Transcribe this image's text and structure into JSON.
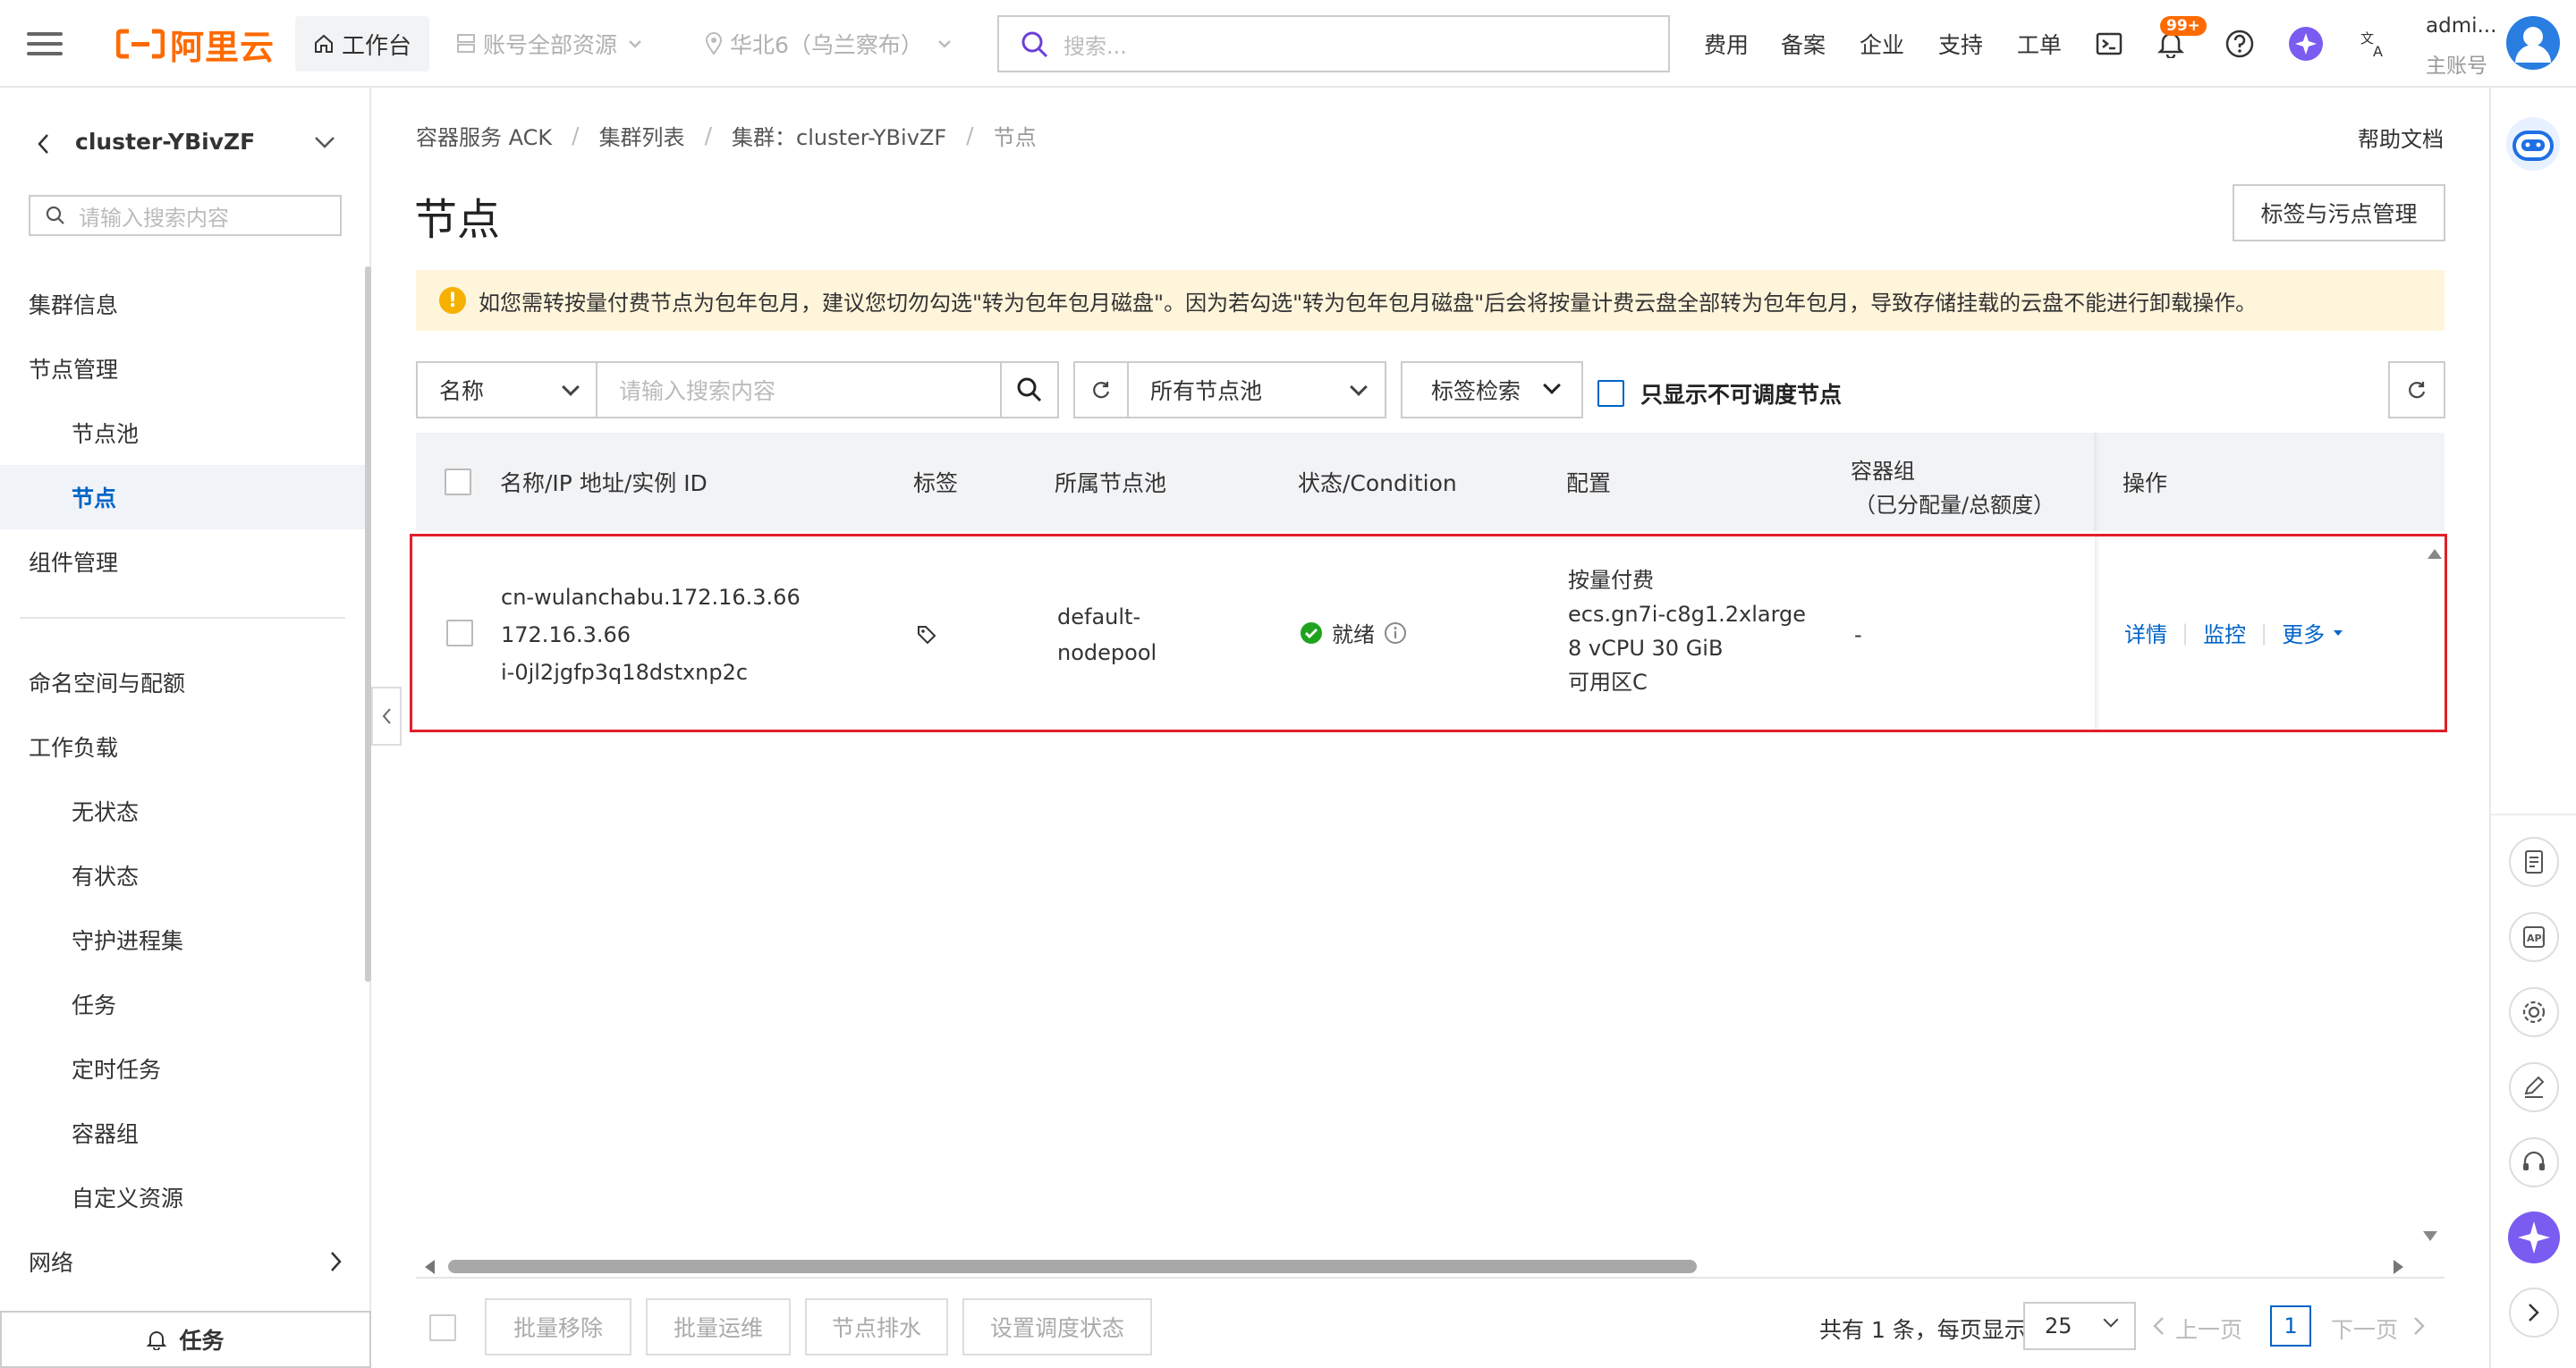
{
  "topbar": {
    "logo": "阿里云",
    "workbench": "工作台",
    "resource_group": "账号全部资源",
    "region": "华北6（乌兰察布）",
    "search_placeholder": "搜索...",
    "links": [
      "费用",
      "备案",
      "企业",
      "支持",
      "工单"
    ],
    "notification_count": "99+",
    "user_name": "admi...",
    "user_role": "主账号"
  },
  "sidebar": {
    "cluster_name": "cluster-YBivZF",
    "search_placeholder": "请输入搜索内容",
    "items": [
      {
        "label": "集群信息"
      },
      {
        "label": "节点管理"
      },
      {
        "label": "节点池"
      },
      {
        "label": "节点"
      },
      {
        "label": "组件管理"
      },
      {
        "label": "命名空间与配额"
      },
      {
        "label": "工作负载"
      },
      {
        "label": "无状态"
      },
      {
        "label": "有状态"
      },
      {
        "label": "守护进程集"
      },
      {
        "label": "任务"
      },
      {
        "label": "定时任务"
      },
      {
        "label": "容器组"
      },
      {
        "label": "自定义资源"
      },
      {
        "label": "网络"
      }
    ],
    "tasks_label": "任务"
  },
  "breadcrumb": [
    "容器服务 ACK",
    "集群列表",
    "集群：cluster-YBivZF",
    "节点"
  ],
  "help_docs": "帮助文档",
  "page_title": "节点",
  "label_taint_button": "标签与污点管理",
  "alert_text": "如您需转按量付费节点为包年包月，建议您切勿勾选\"转为包年包月磁盘\"。因为若勾选\"转为包年包月磁盘\"后会将按量计费云盘全部转为包年包月，导致存储挂载的云盘不能进行卸载操作。",
  "filters": {
    "field_select": "名称",
    "search_placeholder": "请输入搜索内容",
    "nodepool_select": "所有节点池",
    "tag_search": "标签检索",
    "only_unschedulable": "只显示不可调度节点"
  },
  "table": {
    "headers": {
      "name": "名称/IP 地址/实例 ID",
      "tags": "标签",
      "nodepool": "所属节点池",
      "status": "状态/Condition",
      "config": "配置",
      "pods_line1": "容器组",
      "pods_line2": "（已分配量/总额度）",
      "actions": "操作"
    },
    "rows": [
      {
        "name": "cn-wulanchabu.172.16.3.66",
        "ip": "172.16.3.66",
        "instance_id": "i-0jl2jgfp3q18dstxnp2c",
        "nodepool_line1": "default-",
        "nodepool_line2": "nodepool",
        "status": "就绪",
        "config": [
          "按量付费",
          "ecs.gn7i-c8g1.2xlarge",
          "8 vCPU 30 GiB",
          "可用区C"
        ],
        "pods": "-",
        "actions": {
          "detail": "详情",
          "monitor": "监控",
          "more": "更多"
        }
      }
    ]
  },
  "footer": {
    "batch_remove": "批量移除",
    "batch_ops": "批量运维",
    "drain": "节点排水",
    "set_schedule": "设置调度状态",
    "total_text": "共有 1 条，每页显示",
    "page_size": "25",
    "prev": "上一页",
    "page": "1",
    "next": "下一页"
  },
  "colors": {
    "brand": "#ff6a00",
    "link": "#0064c8",
    "highlight_border": "#e0202a",
    "alert_bg": "#fff5db",
    "success": "#1fa31f"
  }
}
